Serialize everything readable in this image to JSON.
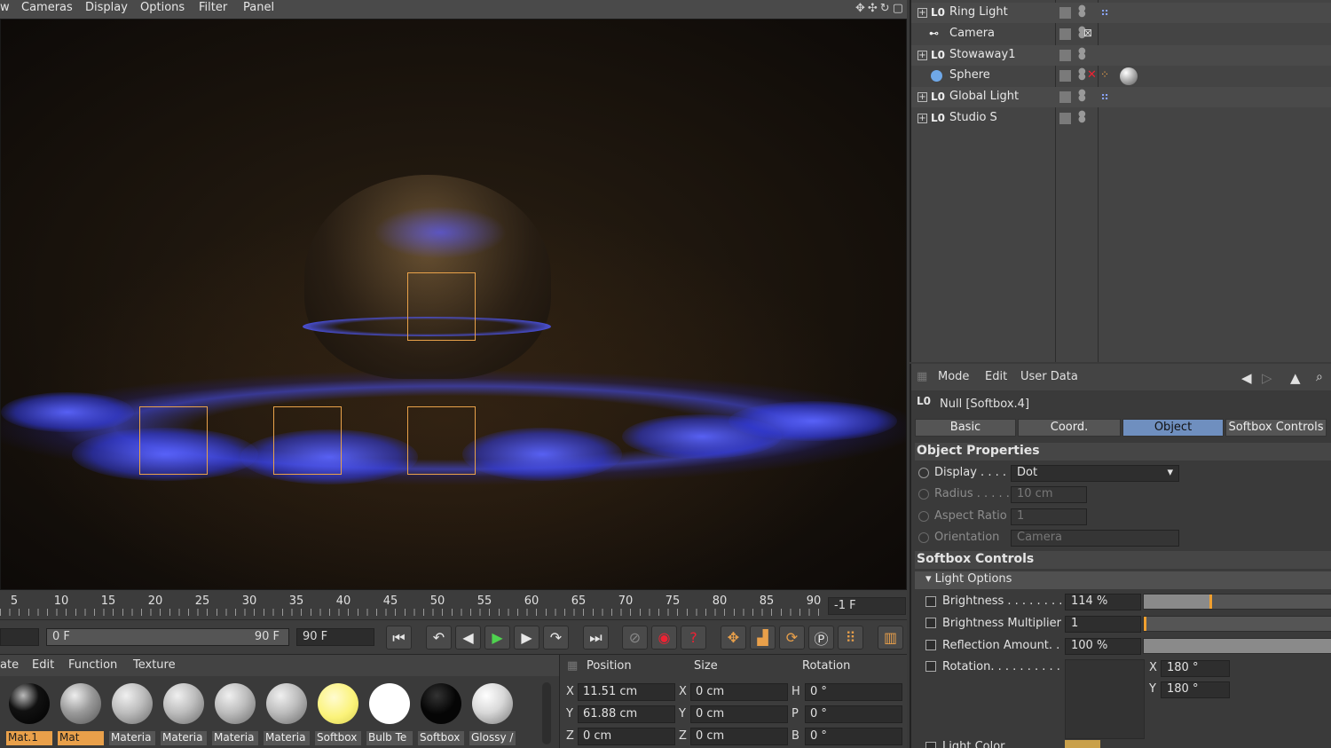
{
  "viewport_menu": {
    "items": [
      "w",
      "Cameras",
      "Display",
      "Options",
      "Filter",
      "Panel"
    ],
    "nav_icons": [
      "move-view-icon",
      "pan-icon",
      "rotate-view-icon",
      "maximize-icon"
    ]
  },
  "timeline": {
    "ticks": [
      "5",
      "10",
      "15",
      "20",
      "25",
      "30",
      "35",
      "40",
      "45",
      "50",
      "55",
      "60",
      "65",
      "70",
      "75",
      "80",
      "85",
      "90"
    ],
    "current_frame": "-1 F",
    "range_start": "0 F",
    "range_end": "90 F",
    "max_frame": "90 F"
  },
  "materials_menu": {
    "items": [
      "ate",
      "Edit",
      "Function",
      "Texture"
    ]
  },
  "materials": [
    {
      "label": "Mat.1",
      "selected": true,
      "color": "#111111"
    },
    {
      "label": "Mat",
      "selected": true,
      "color": "#9a9a9a"
    },
    {
      "label": "Materia",
      "selected": false,
      "color": "#bdbdbd"
    },
    {
      "label": "Materia",
      "selected": false,
      "color": "#bdbdbd"
    },
    {
      "label": "Materia",
      "selected": false,
      "color": "#bdbdbd"
    },
    {
      "label": "Materia",
      "selected": false,
      "color": "#bdbdbd"
    },
    {
      "label": "Softbox",
      "selected": false,
      "color": "#fbf37a"
    },
    {
      "label": "Bulb Te",
      "selected": false,
      "color": "#ffffff"
    },
    {
      "label": "Softbox",
      "selected": false,
      "color": "#0a0a0a"
    },
    {
      "label": "Glossy /",
      "selected": false,
      "color": "#d8d8d8"
    }
  ],
  "coords": {
    "headers": {
      "position": "Position",
      "size": "Size",
      "rotation": "Rotation"
    },
    "rows": [
      {
        "axis": "X",
        "pos": "11.51 cm",
        "size_axis": "X",
        "size": "0 cm",
        "rot_axis": "H",
        "rot": "0 °"
      },
      {
        "axis": "Y",
        "pos": "61.88 cm",
        "size_axis": "Y",
        "size": "0 cm",
        "rot_axis": "P",
        "rot": "0 °"
      },
      {
        "axis": "Z",
        "pos": "0 cm",
        "size_axis": "Z",
        "size": "0 cm",
        "rot_axis": "B",
        "rot": "0 °"
      }
    ]
  },
  "objects": [
    {
      "name": "Ring Light",
      "icon": "L0",
      "expandable": true
    },
    {
      "name": "Camera",
      "icon": "cam",
      "expandable": false
    },
    {
      "name": "Stowaway1",
      "icon": "L0",
      "expandable": true
    },
    {
      "name": "Sphere",
      "icon": "sphere",
      "expandable": false
    },
    {
      "name": "Global Light",
      "icon": "L0",
      "expandable": true
    },
    {
      "name": "Studio S",
      "icon": "L0",
      "expandable": true
    }
  ],
  "attr": {
    "menu": [
      "Mode",
      "Edit",
      "User Data"
    ],
    "object_title": "Null [Softbox.4]",
    "object_icon": "L0",
    "tabs": [
      {
        "label": "Basic",
        "active": false
      },
      {
        "label": "Coord.",
        "active": false
      },
      {
        "label": "Object",
        "active": true
      },
      {
        "label": "Softbox Controls",
        "active": false
      }
    ],
    "object_properties": "Object Properties",
    "display_label": "Display . . . . .",
    "display_value": "Dot",
    "radius_label": "Radius . . . . .",
    "radius_value": "10 cm",
    "aspect_label": "Aspect Ratio",
    "aspect_value": "1",
    "orientation_label": "Orientation",
    "orientation_value": "Camera",
    "softbox_controls": "Softbox Controls",
    "light_options": "Light Options",
    "brightness_label": "Brightness . . . . . . . . .",
    "brightness_value": "114 %",
    "brightness_level": 0.35,
    "multiplier_label": "Brightness Multiplier",
    "multiplier_value": "1",
    "reflection_label": "Reflection Amount. .",
    "reflection_value": "100 %",
    "rotation_label": "Rotation. . . . . . . . . . .",
    "rot_x_label": "X",
    "rot_x": "180 °",
    "rot_y_label": "Y",
    "rot_y": "180 °",
    "light_color_label": "Light Color"
  },
  "colors": {
    "accent": "#e9a04a",
    "active_tab": "#6f8fbf",
    "glow": "#5a64ff"
  }
}
